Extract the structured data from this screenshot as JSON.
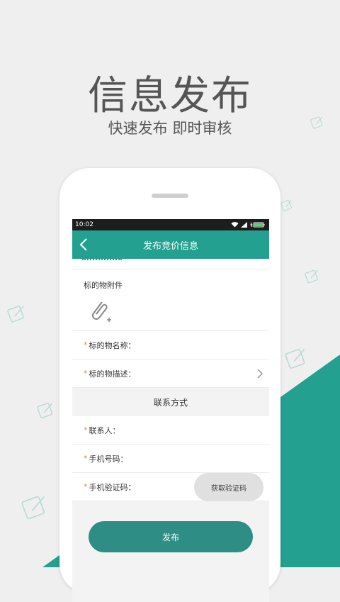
{
  "hero": {
    "title": "信息发布",
    "subtitle": "快速发布 即时审核"
  },
  "status_bar": {
    "time": "10:02"
  },
  "app_bar": {
    "title": "发布竞价信息"
  },
  "form": {
    "attachment_label": "标的物附件",
    "name_label": "标的物名称：",
    "desc_label": "标的物描述：",
    "contact_section": "联系方式",
    "contact_label": "联系人：",
    "phone_label": "手机号码：",
    "code_label": "手机验证码：",
    "get_code_button": "获取验证码",
    "required_mark": "*"
  },
  "submit_button": "发布",
  "colors": {
    "accent": "#23a08f",
    "required": "#f08a2c",
    "background": "#efefef"
  },
  "icons": [
    "back-icon",
    "paperclip-icon",
    "chevron-right-icon",
    "wifi-icon",
    "signal-icon",
    "battery-icon",
    "edit-note-icon"
  ]
}
